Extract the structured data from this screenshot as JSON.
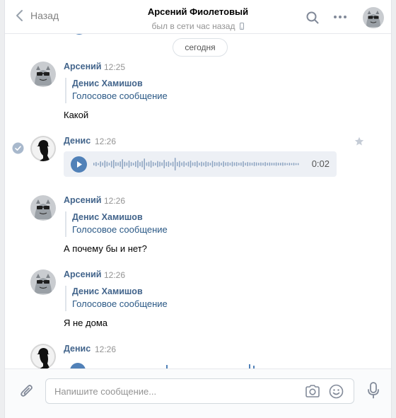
{
  "header": {
    "back_label": "Назад",
    "title": "Арсений Фиолетовый",
    "status": "был в сети час назад"
  },
  "feed": {
    "date_separator": "сегодня",
    "messages": [
      {
        "author": "Арсений",
        "time": "12:25",
        "forward_author": "Денис Хамишов",
        "forward_type": "Голосовое сообщение",
        "text": "Какой"
      },
      {
        "author": "Денис",
        "time": "12:26",
        "voice_duration": "0:02",
        "read": true
      },
      {
        "author": "Арсений",
        "time": "12:26",
        "forward_author": "Денис Хамишов",
        "forward_type": "Голосовое сообщение",
        "text": "А почему бы и нет?"
      },
      {
        "author": "Арсений",
        "time": "12:26",
        "forward_author": "Денис Хамишов",
        "forward_type": "Голосовое сообщение",
        "text": "Я не дома"
      },
      {
        "author": "Денис",
        "time": "12:26"
      }
    ]
  },
  "composer": {
    "placeholder": "Напишите сообщение..."
  },
  "colors": {
    "link": "#2a5885",
    "author": "#42648b",
    "accent": "#5181b8",
    "icon": "#828a99"
  },
  "icons": [
    "chevron-left-icon",
    "phone-icon",
    "search-icon",
    "more-icon",
    "check-circle-icon",
    "star-icon",
    "play-icon",
    "paperclip-icon",
    "camera-icon",
    "smile-icon",
    "microphone-icon"
  ]
}
